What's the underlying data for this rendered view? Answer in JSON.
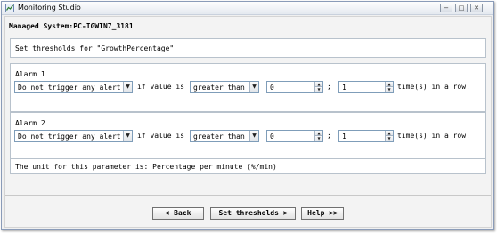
{
  "window": {
    "title": "Monitoring Studio",
    "minimize_symbol": "−",
    "maximize_symbol": "□",
    "close_symbol": "✕"
  },
  "system": {
    "label": "Managed System:PC-IGWIN7_3181"
  },
  "threshold_header": "Set thresholds for \"GrowthPercentage\"",
  "alarms": [
    {
      "title": "Alarm 1",
      "alert_value": "Do not trigger any alert",
      "if_text": "if value is",
      "operator_value": "greater than",
      "threshold_value": "0",
      "separator": ";",
      "times_value": "1",
      "rows_text": "time(s) in a row."
    },
    {
      "title": "Alarm 2",
      "alert_value": "Do not trigger any alert",
      "if_text": "if value is",
      "operator_value": "greater than",
      "threshold_value": "0",
      "separator": ";",
      "times_value": "1",
      "rows_text": "time(s) in a row."
    }
  ],
  "unit_text": "The unit for this parameter is: Percentage per minute (%/min)",
  "buttons": {
    "back": "< Back",
    "set_thresholds": "Set thresholds >",
    "help": "Help >>"
  },
  "icons": {
    "app": "monitoring-studio-icon",
    "dropdown": "chevron-down-icon",
    "spin_up": "spin-up-icon",
    "spin_down": "spin-down-icon"
  }
}
